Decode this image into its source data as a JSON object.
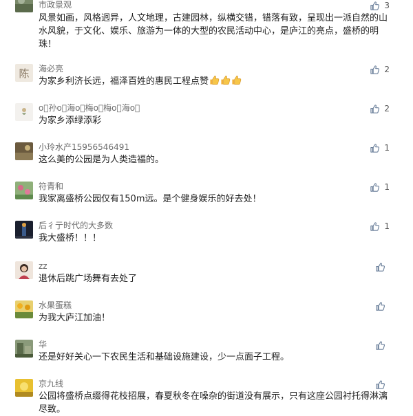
{
  "comments": [
    {
      "nick": "市政景观",
      "text": "风景如画，风格迥异，人文地理，古建园林，纵横交错，错落有致，呈现出一派自然的山水风貌，于文化、娱乐、旅游为一体的大型的农民活动中心，是庐江的亮点，盛桥的明珠！",
      "likes": "3"
    },
    {
      "nick": "海必亮",
      "avatar_text": "陈",
      "text": "为家乡利济长远，福泽百姓的惠民工程点赞",
      "emoji": [
        "thumbs-up",
        "thumbs-up",
        "thumbs-up"
      ],
      "likes": "2"
    },
    {
      "nick": "ο⃝孙ο⃝海ο⃝梅ο⃝梅ο⃝海ο⃝",
      "text": "为家乡添绿添彩",
      "likes": "2"
    },
    {
      "nick": "小玲水产15956546491",
      "text": "这么美的公园是为人类造福的。",
      "likes": "1"
    },
    {
      "nick": "符青和",
      "text": "我家离盛桥公园仅有150m远。是个健身娱乐的好去处！",
      "likes": "1"
    },
    {
      "nick": "后彳亍时代的大多数",
      "text": "我大盛桥！！！",
      "likes": "1"
    },
    {
      "nick": "zz",
      "text": "退休后跳广场舞有去处了",
      "likes": ""
    },
    {
      "nick": "水果蛋糕",
      "text": "为我大庐江加油！",
      "likes": ""
    },
    {
      "nick": "华",
      "text": "还是好好关心一下农民生活和基础设施建设，少一点面子工程。",
      "likes": ""
    },
    {
      "nick": "京九线",
      "text": "公园将盛桥点缀得花枝招展，春夏秋冬在噪杂的街道没有展示，只有这座公园衬托得淋漓尽致。",
      "likes": ""
    }
  ],
  "colors": {
    "nick": "#6a6a6a",
    "text": "#1f1f1f",
    "like_icon": "#6a7f9a"
  },
  "icons": {
    "like": "thumbs-up-icon"
  }
}
